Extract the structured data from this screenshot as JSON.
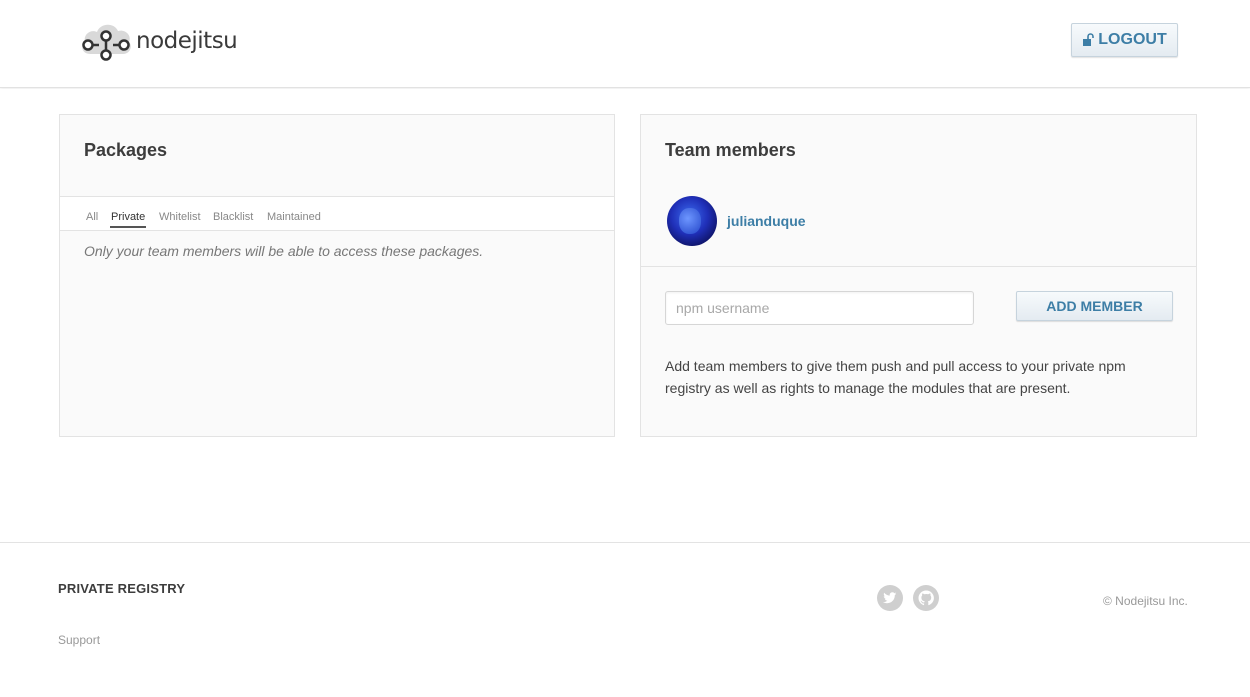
{
  "header": {
    "logo_text": "nodejitsu",
    "logout_label": "LOGOUT"
  },
  "packages": {
    "title": "Packages",
    "tabs": [
      {
        "label": "All",
        "active": false
      },
      {
        "label": "Private",
        "active": true
      },
      {
        "label": "Whitelist",
        "active": false
      },
      {
        "label": "Blacklist",
        "active": false
      },
      {
        "label": "Maintained",
        "active": false
      }
    ],
    "note": "Only your team members will be able to access these packages."
  },
  "team": {
    "title": "Team members",
    "members": [
      {
        "username": "julianduque"
      }
    ],
    "input_placeholder": "npm username",
    "add_label": "ADD MEMBER",
    "description": "Add team members to give them push and pull access to your private npm registry as well as rights to manage the modules that are present."
  },
  "footer": {
    "brand": "PRIVATE REGISTRY",
    "support_link": "Support",
    "copyright": "© Nodejitsu Inc.",
    "social_icons": [
      "twitter-icon",
      "github-icon"
    ]
  },
  "colors": {
    "accent": "#3d7ea6",
    "panel_bg": "#fafafa",
    "muted": "#999999"
  }
}
